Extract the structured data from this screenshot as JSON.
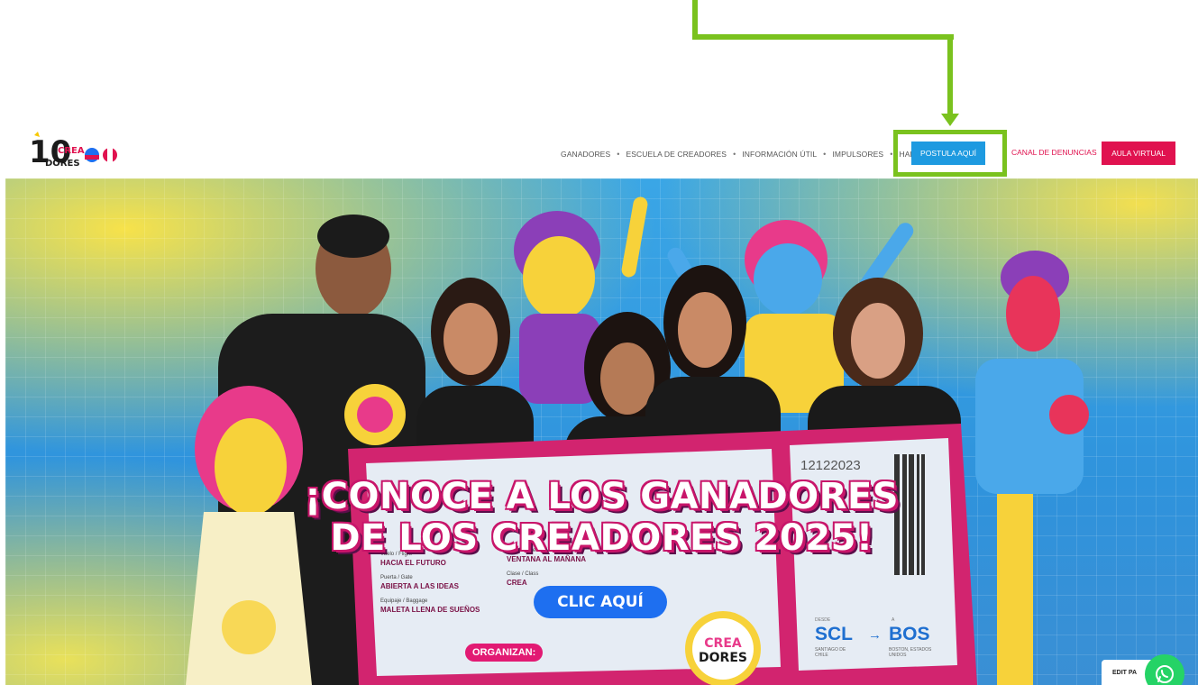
{
  "brand": {
    "logo_number": "10",
    "logo_text_top": "CREA",
    "logo_text_bottom": "DORES"
  },
  "nav": {
    "items": [
      {
        "label": "GANADORES"
      },
      {
        "label": "ESCUELA DE CREADORES"
      },
      {
        "label": "INFORMACIÓN ÚTIL"
      },
      {
        "label": "IMPULSORES"
      },
      {
        "label": "HABLEMOS"
      }
    ],
    "separator": "•",
    "cta_primary": "POSTULA AQUÍ",
    "link_report": "CANAL DE DENUNCIAS",
    "cta_secondary": "AULA VIRTUAL"
  },
  "hero": {
    "headline_line1": "¡CONOCE A LOS GANADORES",
    "headline_line2": "DE LOS CREADORES 2025!",
    "cta": "CLIC AQUÍ",
    "organizers_label": "ORGANIZAN:",
    "ticket": {
      "number": "12122023",
      "fields": [
        {
          "label": "Vuelo / Flight",
          "value": "HACIA EL FUTURO"
        },
        {
          "label": "Puerta / Gate",
          "value": "ABIERTA A LAS IDEAS"
        },
        {
          "label": "Equipaje / Baggage",
          "value": "MALETA LLENA DE SUEÑOS"
        },
        {
          "label": "Asiento / Seat",
          "value": "VENTANA AL MAÑANA"
        },
        {
          "label": "Clase / Class",
          "value": "CREA"
        }
      ],
      "from_label": "DESDE",
      "from_code": "SCL",
      "from_city": "SANTIAGO DE CHILE",
      "to_label": "A",
      "to_code": "BOS",
      "to_city": "BOSTON, ESTADOS UNIDOS",
      "arrow": "→"
    },
    "badge_text_top": "CREA",
    "badge_text_bottom": "DORES"
  },
  "floating": {
    "edit_page": "EDIT PA"
  },
  "colors": {
    "primary_blue": "#1e9ae0",
    "accent_pink": "#e0124f",
    "annotation_green": "#7ac21e"
  }
}
